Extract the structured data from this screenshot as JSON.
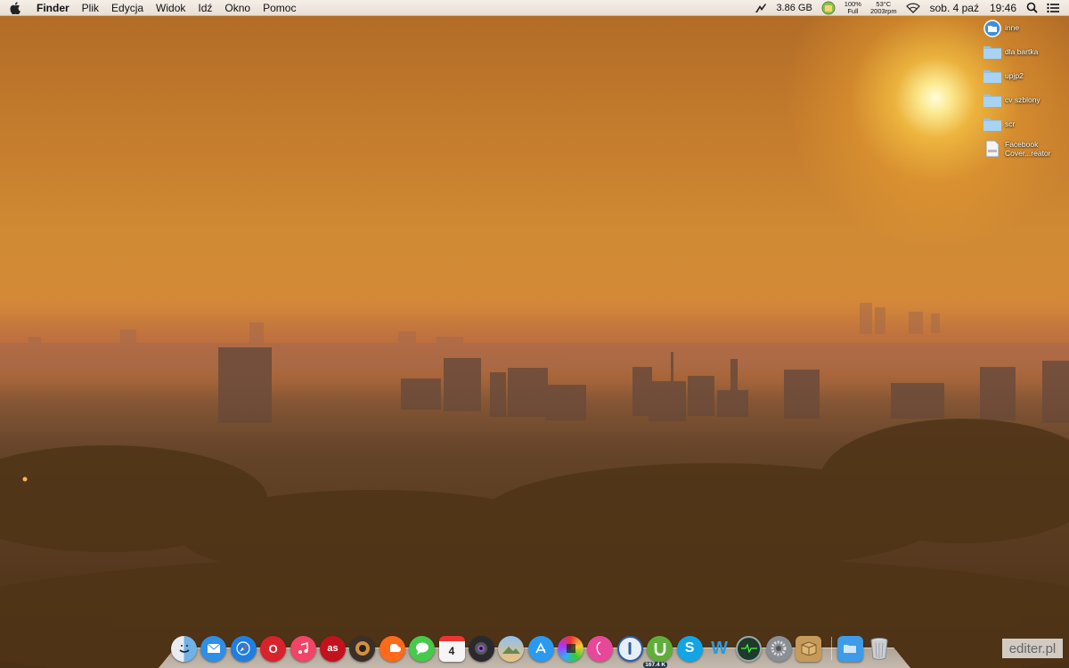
{
  "menubar": {
    "app_name": "Finder",
    "menus": [
      "Plik",
      "Edycja",
      "Widok",
      "Idź",
      "Okno",
      "Pomoc"
    ],
    "memory": "3.86 GB",
    "battery_percent": "100%",
    "battery_state": "Full",
    "temperature": "53°C",
    "fan_speed": "2003rpm",
    "date": "sob. 4 paź",
    "time": "19:46"
  },
  "desktop": {
    "items": [
      {
        "label": "inne",
        "icon": "blue-circle-folder-icon"
      },
      {
        "label": "dla bartka",
        "icon": "folder-icon"
      },
      {
        "label": "upjp2",
        "icon": "folder-icon"
      },
      {
        "label": "cv szblony",
        "icon": "folder-icon"
      },
      {
        "label": "scr",
        "icon": "folder-icon"
      },
      {
        "label": "Facebook Cover...reator",
        "icon": "html-file-icon"
      }
    ],
    "facebook_line1": "Facebook",
    "facebook_line2": "Cover...reator"
  },
  "dock": {
    "apps": [
      {
        "name": "finder-icon",
        "color": "#e8ecef"
      },
      {
        "name": "mail-icon",
        "color": "#2f8ee6"
      },
      {
        "name": "safari-icon",
        "color": "#1e7fe0"
      },
      {
        "name": "opera-icon",
        "color": "#d8222c"
      },
      {
        "name": "itunes-icon",
        "color": "#f24466"
      },
      {
        "name": "lastfm-icon",
        "color": "#c3121e"
      },
      {
        "name": "speakers-icon",
        "color": "#3a302a"
      },
      {
        "name": "soundcloud-icon",
        "color": "#ff6a1a"
      },
      {
        "name": "messages-icon",
        "color": "#47c94b"
      },
      {
        "name": "calendar-icon",
        "color": "#f5f5f5"
      },
      {
        "name": "photo-booth-icon",
        "color": "#2a2a2e"
      },
      {
        "name": "preview-icon",
        "color": "#6fa8dc"
      },
      {
        "name": "app-store-icon",
        "color": "#2a9af0"
      },
      {
        "name": "final-cut-icon",
        "color": "#4a4a4a"
      },
      {
        "name": "pinwheel-icon",
        "color": "#e8489a"
      },
      {
        "name": "1password-icon",
        "color": "#2b5fa8"
      },
      {
        "name": "utorrent-icon",
        "color": "#5fae3a"
      },
      {
        "name": "skype-icon",
        "color": "#12a5e6"
      },
      {
        "name": "word-icon",
        "color": "#2b9be0"
      },
      {
        "name": "activity-monitor-icon",
        "color": "#1f3a2a"
      },
      {
        "name": "system-preferences-icon",
        "color": "#8a8f96"
      },
      {
        "name": "unarchiver-icon",
        "color": "#c69a5a"
      }
    ],
    "calendar_day": "4",
    "utorrent_badge": "167.4 K",
    "opera_letter": "O",
    "lastfm_label": "as",
    "skype_letter": "S",
    "word_letter": "W",
    "downloads_stack": {
      "name": "downloads-folder-icon",
      "color": "#3e9be8"
    },
    "trash": {
      "name": "trash-icon"
    }
  },
  "watermark": "editer.pl"
}
